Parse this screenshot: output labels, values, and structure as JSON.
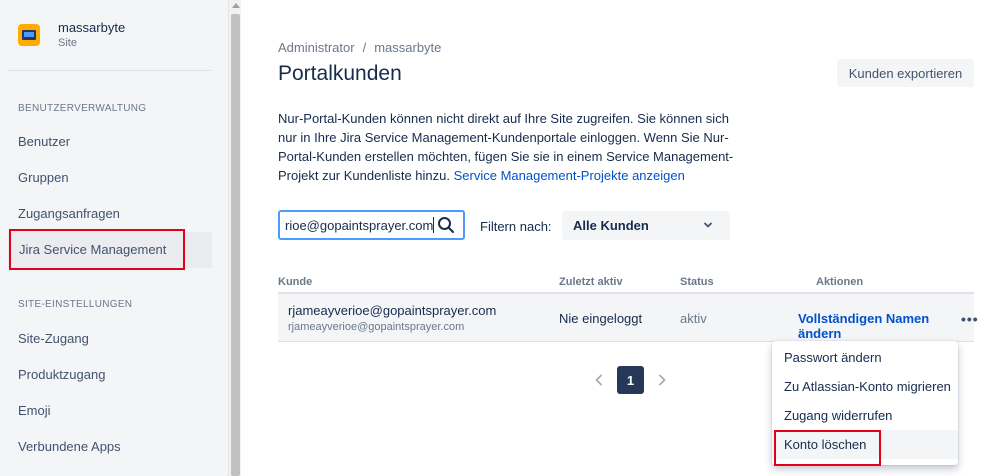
{
  "sidebar": {
    "site_name": "massarbyte",
    "site_sub": "Site",
    "section_user_mgmt": "BENUTZERVERWALTUNG",
    "user_items": [
      {
        "label": "Benutzer"
      },
      {
        "label": "Gruppen"
      },
      {
        "label": "Zugangsanfragen"
      },
      {
        "label": "Jira Service Management",
        "selected": true
      }
    ],
    "section_site": "SITE-EINSTELLUNGEN",
    "site_items": [
      {
        "label": "Site-Zugang"
      },
      {
        "label": "Produktzugang"
      },
      {
        "label": "Emoji"
      },
      {
        "label": "Verbundene Apps"
      }
    ]
  },
  "header": {
    "breadcrumb": [
      "Administrator",
      "/",
      "massarbyte"
    ],
    "title": "Portalkunden",
    "export_label": "Kunden exportieren"
  },
  "description": {
    "text": "Nur-Portal-Kunden können nicht direkt auf Ihre Site zugreifen. Sie können sich nur in Ihre Jira Service Management-Kundenportale einloggen. Wenn Sie Nur-Portal-Kunden erstellen möchten, fügen Sie sie in einem Service Management-Projekt zur Kundenliste hinzu.",
    "link": "Service Management-Projekte anzeigen"
  },
  "search": {
    "value": "rioe@gopaintsprayer.com"
  },
  "filter": {
    "label": "Filtern nach:",
    "selected": "Alle Kunden"
  },
  "table": {
    "columns": [
      "Kunde",
      "Zuletzt aktiv",
      "Status",
      "Aktionen"
    ],
    "rows": [
      {
        "email": "rjameayverioe@gopaintsprayer.com",
        "email_sub": "rjameayverioe@gopaintsprayer.com",
        "last_active": "Nie eingeloggt",
        "status": "aktiv",
        "action": "Vollständigen Namen ändern",
        "more": "•••"
      }
    ]
  },
  "pagination": {
    "current": "1"
  },
  "dropdown": {
    "items": [
      {
        "label": "Passwort ändern"
      },
      {
        "label": "Zu Atlassian-Konto migrieren"
      },
      {
        "label": "Zugang widerrufen"
      },
      {
        "label": "Konto löschen",
        "highlight": true
      }
    ]
  },
  "colors": {
    "brand_link": "#0052cc",
    "highlight_border": "#e2001a",
    "page_current": "#253858",
    "search_border": "#4c9aff"
  },
  "icons": [
    "site-logo-icon",
    "search-icon",
    "chevron-down-icon",
    "chevron-left-icon",
    "chevron-right-icon",
    "more-icon"
  ]
}
